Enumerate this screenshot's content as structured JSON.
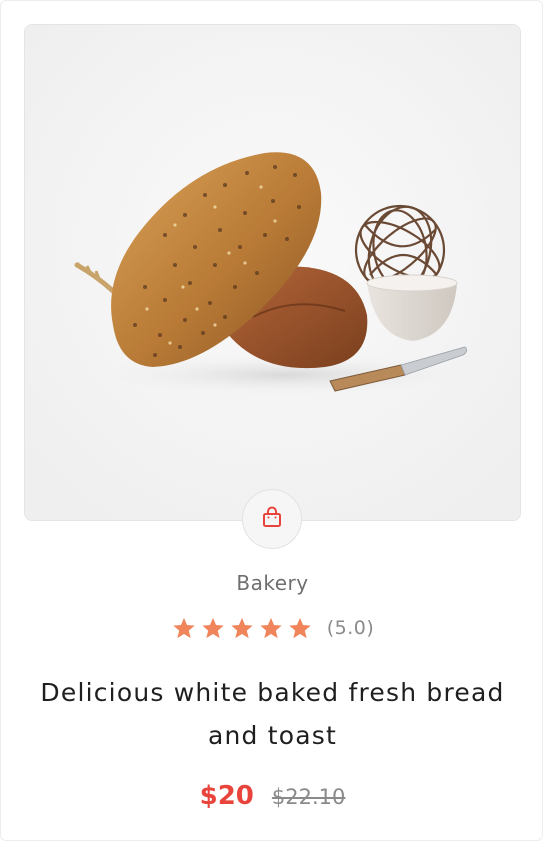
{
  "product": {
    "image_alt": "bread-loaves-photo",
    "category": "Bakery",
    "rating": {
      "stars": 5,
      "max_stars": 5,
      "text": "(5.0)",
      "star_color": "#f0845a"
    },
    "title": "Delicious white baked fresh bread and toast",
    "price_current": "$20",
    "price_old": "$22.10"
  },
  "cart_button": {
    "icon": "shopping-bag-icon",
    "color": "#e8443b"
  },
  "colors": {
    "accent": "#e8443b",
    "star": "#f0845a",
    "text_muted": "#8a8a8a",
    "text_dark": "#1f1f1f"
  }
}
